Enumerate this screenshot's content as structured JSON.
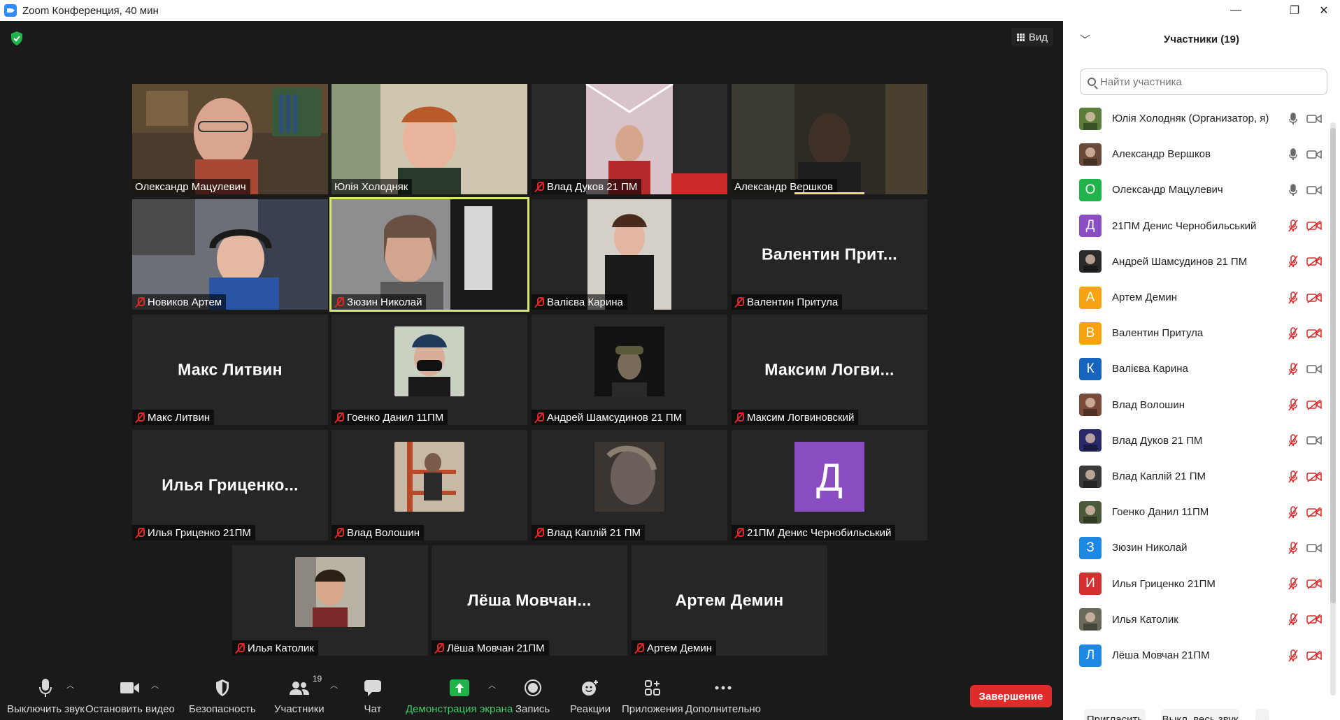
{
  "window": {
    "title": "Zoom Конференция, 40 мин",
    "minimize": "—",
    "restore": "❐",
    "close": "✕"
  },
  "view_button": {
    "label": "Вид"
  },
  "tiles": [
    {
      "name": "Олександр Мацулевич",
      "muted": false,
      "video": "bookshelf-man"
    },
    {
      "name": "Юлія Холодняк",
      "muted": false,
      "video": "woman-plant"
    },
    {
      "name": "Влад Дуков 21 ПМ",
      "muted": true,
      "video": "boy-lights"
    },
    {
      "name": "Александр Вершков",
      "muted": false,
      "video": "man-dark",
      "speaking": true
    },
    {
      "name": "Новиков Артем",
      "muted": true,
      "video": "boy-headphones"
    },
    {
      "name": "Зюзин Николай",
      "muted": true,
      "video": "man-window",
      "active": true
    },
    {
      "name": "Валієва Карина",
      "muted": true,
      "video": "girl-glasses"
    },
    {
      "name": "Валентин Притула",
      "muted": true,
      "big_name": "Валентин  Прит..."
    },
    {
      "name": "Макс Литвин",
      "muted": true,
      "big_name": "Макс Литвин"
    },
    {
      "name": "Гоенко Данил 11ПМ",
      "muted": true,
      "thumb": "mask"
    },
    {
      "name": "Андрей Шамсудинов 21 ПМ",
      "muted": true,
      "thumb": "cap-dark"
    },
    {
      "name": "Максим Логвиновский",
      "muted": true,
      "big_name": "Максим  Логви..."
    },
    {
      "name": "Илья Гриценко 21ПМ",
      "muted": true,
      "big_name": "Илья  Гриценко..."
    },
    {
      "name": "Влад Волошин",
      "muted": true,
      "thumb": "ladder"
    },
    {
      "name": "Влад Каплій 21 ПМ",
      "muted": true,
      "thumb": "blur-face"
    },
    {
      "name": "21ПМ Денис Чернобильський",
      "muted": true,
      "avatar_letter": "Д"
    },
    {
      "name": "Илья Католик",
      "muted": true,
      "thumb": "boy-portrait"
    },
    {
      "name": "Лёша Мовчан 21ПМ",
      "muted": true,
      "big_name": "Лёша  Мовчан..."
    },
    {
      "name": "Артем Демин",
      "muted": true,
      "big_name": "Артем Демин"
    }
  ],
  "toolbar": {
    "mute": "Выключить звук",
    "stop_video": "Остановить видео",
    "security": "Безопасность",
    "participants": "Участники",
    "participants_count": "19",
    "chat": "Чат",
    "share": "Демонстрация экрана",
    "record": "Запись",
    "reactions": "Реакции",
    "apps": "Приложения",
    "more": "Дополнительно",
    "end": "Завершение"
  },
  "panel": {
    "title": "Участники (19)",
    "search_placeholder": "Найти участника",
    "invite": "Пригласить",
    "mute_all": "Выкл. весь звук",
    "more": "...",
    "participants": [
      {
        "name": "Юлія Холодняк (Организатор, я)",
        "avatar": "photo",
        "color": "#5a7d3a",
        "mic": "on",
        "cam": "on"
      },
      {
        "name": "Александр Вершков",
        "avatar": "photo",
        "color": "#6b4a3a",
        "mic": "on",
        "cam": "on"
      },
      {
        "name": "Олександр Мацулевич",
        "avatar": "О",
        "color": "#1fb34a",
        "mic": "on",
        "cam": "on"
      },
      {
        "name": "21ПМ Денис Чернобильський",
        "avatar": "Д",
        "color": "#8a4dc2",
        "mic": "off",
        "cam": "off"
      },
      {
        "name": "Андрей Шамсудинов 21 ПМ",
        "avatar": "photo",
        "color": "#2a2a2a",
        "mic": "off",
        "cam": "off"
      },
      {
        "name": "Артем Демин",
        "avatar": "А",
        "color": "#f5a312",
        "mic": "off",
        "cam": "off"
      },
      {
        "name": "Валентин Притула",
        "avatar": "В",
        "color": "#f5a312",
        "mic": "off",
        "cam": "off"
      },
      {
        "name": "Валієва Карина",
        "avatar": "К",
        "color": "#1565c0",
        "mic": "off",
        "cam": "on"
      },
      {
        "name": "Влад Волошин",
        "avatar": "photo",
        "color": "#7a4a3a",
        "mic": "off",
        "cam": "off"
      },
      {
        "name": "Влад Дуков 21 ПМ",
        "avatar": "photo",
        "color": "#2a2a6a",
        "mic": "off",
        "cam": "on"
      },
      {
        "name": "Влад Каплій 21 ПМ",
        "avatar": "photo",
        "color": "#3a3a3a",
        "mic": "off",
        "cam": "off"
      },
      {
        "name": "Гоенко Данил 11ПМ",
        "avatar": "photo",
        "color": "#4a5a3a",
        "mic": "off",
        "cam": "off"
      },
      {
        "name": "Зюзин Николай",
        "avatar": "З",
        "color": "#1e88e5",
        "mic": "off",
        "cam": "on"
      },
      {
        "name": "Илья Гриценко 21ПМ",
        "avatar": "И",
        "color": "#d32f2f",
        "mic": "off",
        "cam": "off"
      },
      {
        "name": "Илья Католик",
        "avatar": "photo",
        "color": "#6a6a5a",
        "mic": "off",
        "cam": "off"
      },
      {
        "name": "Лёша Мовчан 21ПМ",
        "avatar": "Л",
        "color": "#1e88e5",
        "mic": "off",
        "cam": "off"
      }
    ]
  }
}
